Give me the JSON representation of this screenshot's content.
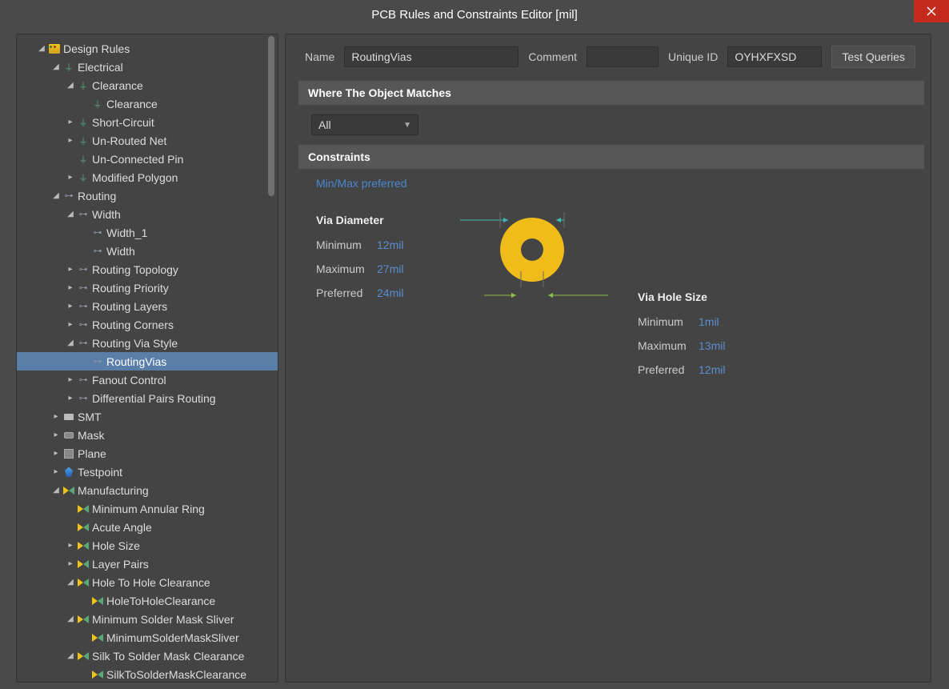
{
  "title": "PCB Rules and Constraints Editor [mil]",
  "tree": {
    "root": "Design Rules",
    "electrical": "Electrical",
    "clearance_cat": "Clearance",
    "clearance_rule": "Clearance",
    "short_circuit": "Short-Circuit",
    "unrouted_net": "Un-Routed Net",
    "unconnected_pin": "Un-Connected Pin",
    "modified_polygon": "Modified Polygon",
    "routing": "Routing",
    "width_cat": "Width",
    "width_1": "Width_1",
    "width_rule": "Width",
    "routing_topology": "Routing Topology",
    "routing_priority": "Routing Priority",
    "routing_layers": "Routing Layers",
    "routing_corners": "Routing Corners",
    "routing_via_style": "Routing Via Style",
    "routing_vias": "RoutingVias",
    "fanout_control": "Fanout Control",
    "diff_pairs": "Differential Pairs Routing",
    "smt": "SMT",
    "mask": "Mask",
    "plane": "Plane",
    "testpoint": "Testpoint",
    "manufacturing": "Manufacturing",
    "min_annular": "Minimum Annular Ring",
    "acute_angle": "Acute Angle",
    "hole_size": "Hole Size",
    "layer_pairs": "Layer Pairs",
    "hth_clearance": "Hole To Hole Clearance",
    "hth_rule": "HoleToHoleClearance",
    "min_sms": "Minimum Solder Mask Sliver",
    "min_sms_rule": "MinimumSolderMaskSliver",
    "stsm": "Silk To Solder Mask Clearance",
    "stsm_rule": "SilkToSolderMaskClearance"
  },
  "form": {
    "name_label": "Name",
    "name_value": "RoutingVias",
    "comment_label": "Comment",
    "comment_value": "",
    "uid_label": "Unique ID",
    "uid_value": "OYHXFXSD",
    "test_queries": "Test Queries"
  },
  "sections": {
    "match": "Where The Object Matches",
    "constraints": "Constraints"
  },
  "match_scope": "All",
  "constraints": {
    "link": "Min/Max preferred",
    "via_diameter_title": "Via Diameter",
    "via_hole_title": "Via Hole Size",
    "min_label": "Minimum",
    "max_label": "Maximum",
    "pref_label": "Preferred",
    "dia_min": "12mil",
    "dia_max": "27mil",
    "dia_pref": "24mil",
    "hole_min": "1mil",
    "hole_max": "13mil",
    "hole_pref": "12mil"
  }
}
